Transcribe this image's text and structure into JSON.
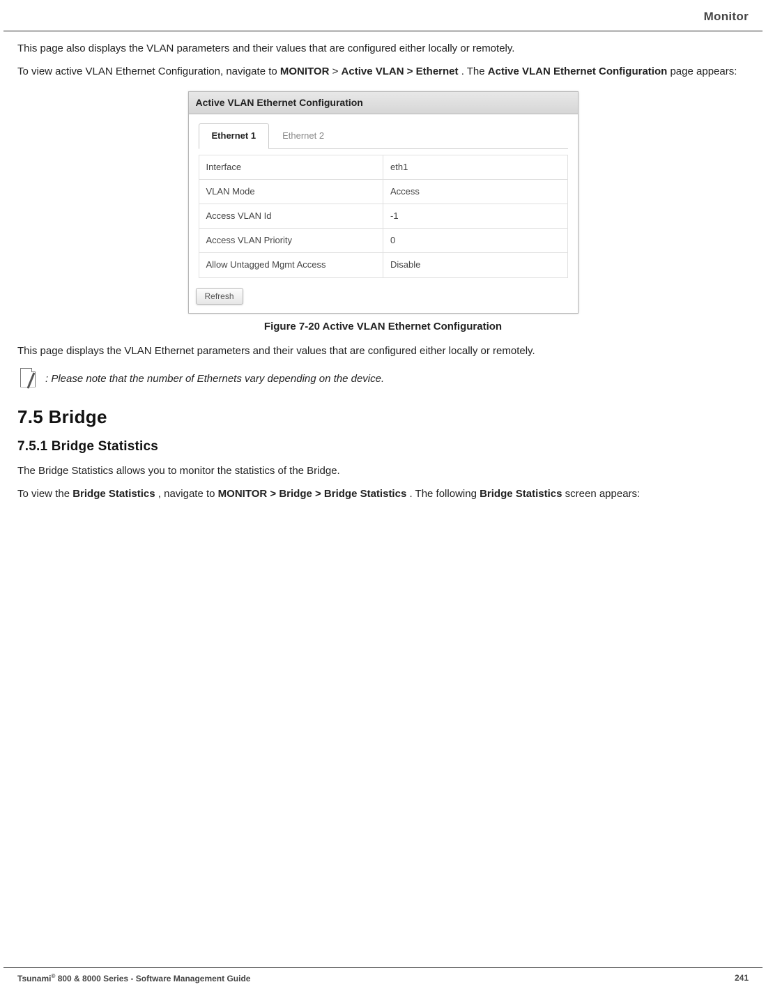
{
  "header": {
    "section": "Monitor"
  },
  "intro": {
    "para1": "This page also displays the VLAN parameters and their values that are configured either locally or remotely.",
    "para2_pre": "To view active VLAN Ethernet Configuration, navigate to ",
    "para2_nav1": "MONITOR",
    "para2_nav2": "Active VLAN > Ethernet",
    "para2_mid": ". The ",
    "para2_bold": "Active VLAN Ethernet Configuration",
    "para2_post": " page appears:",
    "gt": " > "
  },
  "figure": {
    "panel_title": "Active VLAN Ethernet Configuration",
    "tabs": [
      "Ethernet 1",
      "Ethernet 2"
    ],
    "rows": [
      {
        "label": "Interface",
        "value": "eth1"
      },
      {
        "label": "VLAN Mode",
        "value": "Access"
      },
      {
        "label": "Access VLAN Id",
        "value": "-1"
      },
      {
        "label": "Access VLAN Priority",
        "value": "0"
      },
      {
        "label": "Allow Untagged Mgmt Access",
        "value": "Disable"
      }
    ],
    "refresh_label": "Refresh",
    "caption": "Figure 7-20 Active VLAN Ethernet Configuration"
  },
  "after_figure": {
    "para": "This page displays the VLAN Ethernet parameters and their values that are configured either locally or remotely.",
    "note": ": Please note that the number of Ethernets vary depending on the device."
  },
  "section": {
    "h2": "7.5 Bridge",
    "h3": "7.5.1 Bridge Statistics",
    "p1": "The Bridge Statistics allows you to monitor the statistics of the Bridge.",
    "p2_pre": "To view the ",
    "p2_b1": "Bridge Statistics",
    "p2_mid1": ", navigate to ",
    "p2_b2": "MONITOR > Bridge > Bridge Statistics",
    "p2_mid2": ". The following ",
    "p2_b3": "Bridge Statistics",
    "p2_post": " screen appears:"
  },
  "footer": {
    "left_pre": "Tsunami",
    "left_post": " 800 & 8000 Series - Software Management Guide",
    "page": "241"
  }
}
